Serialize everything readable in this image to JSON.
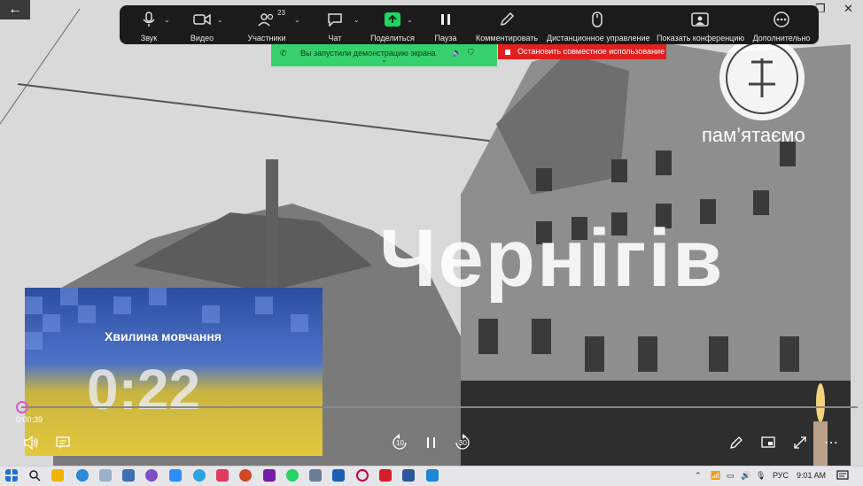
{
  "window": {
    "back_glyph": "←",
    "restore_glyph": "❐",
    "close_glyph": "✕"
  },
  "toolbar": {
    "items": [
      {
        "label": "Звук",
        "icon": "microphone-icon",
        "has_caret": true
      },
      {
        "label": "Видео",
        "icon": "video-camera-icon",
        "has_caret": true
      },
      {
        "label": "Участники",
        "icon": "participants-icon",
        "has_caret": true,
        "count": "23"
      },
      {
        "label": "Чат",
        "icon": "chat-icon",
        "has_caret": true
      },
      {
        "label": "Поделиться",
        "icon": "share-screen-icon",
        "has_caret": true
      },
      {
        "label": "Пауза",
        "icon": "pause-icon",
        "has_caret": false
      },
      {
        "label": "Комментировать",
        "icon": "pencil-icon",
        "has_caret": false
      },
      {
        "label": "Дистанционное управление",
        "icon": "mouse-icon",
        "has_caret": false
      },
      {
        "label": "Показать конференцию",
        "icon": "show-meeting-icon",
        "has_caret": false
      },
      {
        "label": "Дополнительно",
        "icon": "more-icon",
        "has_caret": false
      }
    ]
  },
  "share_banner": {
    "text": "Вы запустили демонстрацию экрана",
    "stop_label": "Остановить совместное использование"
  },
  "video": {
    "overlay_brand": "пам’ятаємо",
    "city": "Чернігів",
    "minute_of_silence": "Хвилина мовчання",
    "countdown": "0:22"
  },
  "player": {
    "elapsed": "0:00:39",
    "progress_fraction": 0.004,
    "rewind_label": "10",
    "forward_label": "30"
  },
  "taskbar": {
    "language": "РУС",
    "time": "9:01 AM"
  },
  "colors": {
    "toolbar_bg": "#1b1b1b",
    "share_green": "#36d16d",
    "stop_red": "#e02020",
    "progress_accent": "#d35ad3"
  }
}
